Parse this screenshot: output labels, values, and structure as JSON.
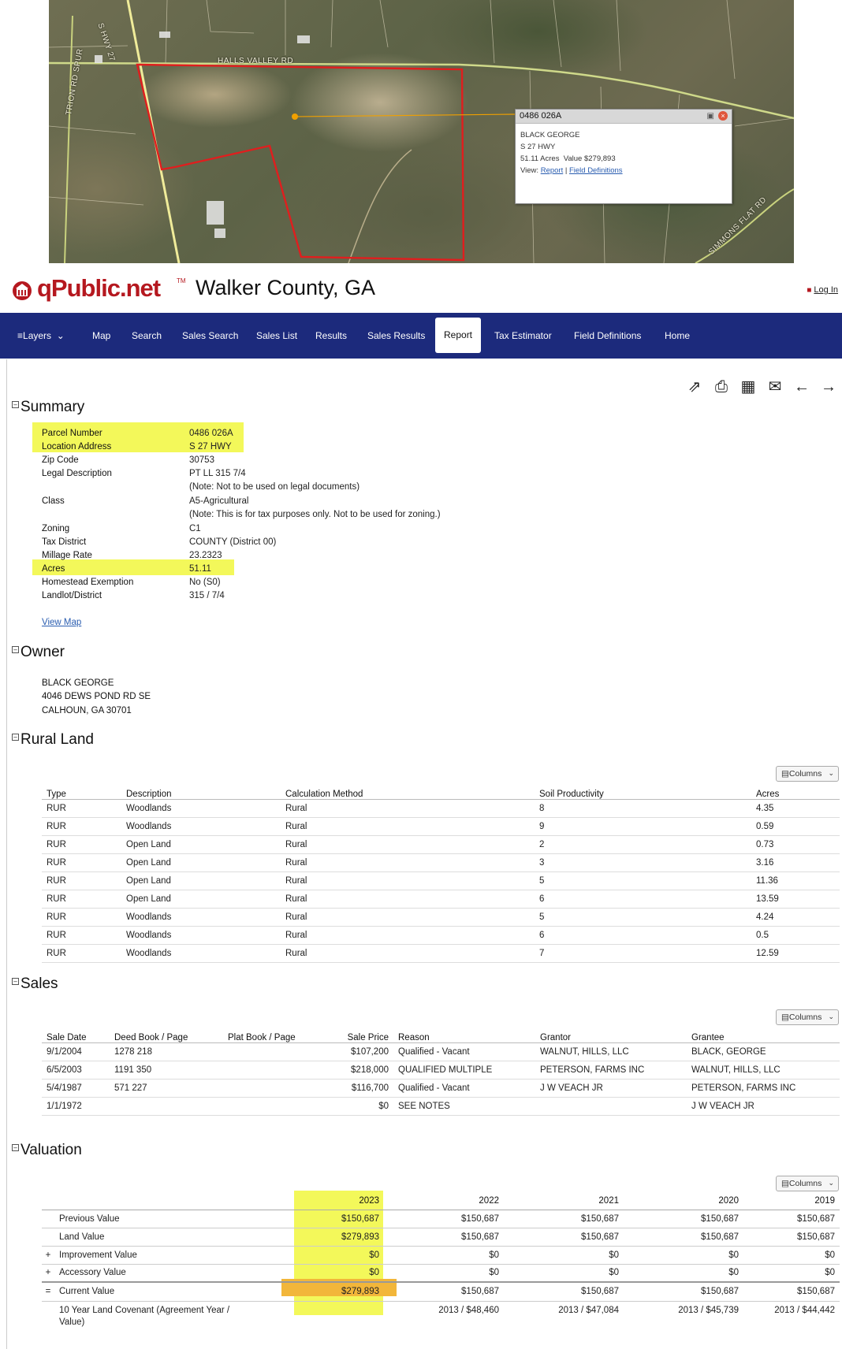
{
  "map": {
    "road_labels": {
      "halls_valley": "HALLS VALLEY RD",
      "hwy27": "S HWY 27",
      "trion_spur": "TRION RD SPUR",
      "simmons": "SIMMONS FLAT RD"
    },
    "popup": {
      "parcel": "0486 026A",
      "owner": "BLACK GEORGE",
      "address": "S 27 HWY",
      "acres_value": "51.11 Acres  Value $279,893",
      "view_label": "View:",
      "report_link": "Report",
      "separator": "|",
      "defs_link": "Field Definitions"
    }
  },
  "header": {
    "logo_text": "qPublic.net",
    "tm": "TM",
    "county": "Walker County, GA",
    "login": "Log In"
  },
  "nav": {
    "items": [
      "Layers",
      "Map",
      "Search",
      "Sales Search",
      "Sales List",
      "Results",
      "Sales Results",
      "Report",
      "Tax Estimator",
      "Field Definitions",
      "Home"
    ],
    "active": "Report"
  },
  "summary": {
    "title": "Summary",
    "rows": [
      {
        "k": "Parcel Number",
        "v": "0486 026A"
      },
      {
        "k": "Location Address",
        "v": "S 27 HWY"
      },
      {
        "k": "Zip Code",
        "v": "30753"
      },
      {
        "k": "Legal Description",
        "v": "PT LL 315 7/4"
      },
      {
        "k": "",
        "v": "(Note: Not to be used on legal documents)"
      },
      {
        "k": "Class",
        "v": "A5-Agricultural"
      },
      {
        "k": "",
        "v": "(Note: This is for tax purposes only. Not to be used for zoning.)"
      },
      {
        "k": "Zoning",
        "v": "C1"
      },
      {
        "k": "Tax District",
        "v": "COUNTY (District 00)"
      },
      {
        "k": "Millage Rate",
        "v": "23.2323"
      },
      {
        "k": "Acres",
        "v": "51.11"
      },
      {
        "k": "Homestead Exemption",
        "v": "No (S0)"
      },
      {
        "k": "Landlot/District",
        "v": "315 / 7/4"
      }
    ],
    "view_map": "View Map"
  },
  "owner": {
    "title": "Owner",
    "lines": [
      "BLACK GEORGE",
      "4046 DEWS POND RD SE",
      "CALHOUN, GA 30701"
    ]
  },
  "columns_label": "Columns",
  "rural_land": {
    "title": "Rural Land",
    "headers": [
      "Type",
      "Description",
      "Calculation Method",
      "Soil Productivity",
      "Acres"
    ],
    "rows": [
      [
        "RUR",
        "Woodlands",
        "Rural",
        "8",
        "4.35"
      ],
      [
        "RUR",
        "Woodlands",
        "Rural",
        "9",
        "0.59"
      ],
      [
        "RUR",
        "Open Land",
        "Rural",
        "2",
        "0.73"
      ],
      [
        "RUR",
        "Open Land",
        "Rural",
        "3",
        "3.16"
      ],
      [
        "RUR",
        "Open Land",
        "Rural",
        "5",
        "11.36"
      ],
      [
        "RUR",
        "Open Land",
        "Rural",
        "6",
        "13.59"
      ],
      [
        "RUR",
        "Woodlands",
        "Rural",
        "5",
        "4.24"
      ],
      [
        "RUR",
        "Woodlands",
        "Rural",
        "6",
        "0.5"
      ],
      [
        "RUR",
        "Woodlands",
        "Rural",
        "7",
        "12.59"
      ]
    ]
  },
  "sales": {
    "title": "Sales",
    "headers": [
      "Sale Date",
      "Deed Book / Page",
      "Plat Book / Page",
      "Sale Price",
      "Reason",
      "Grantor",
      "Grantee"
    ],
    "rows": [
      [
        "9/1/2004",
        "1278 218",
        "",
        "$107,200",
        "Qualified - Vacant",
        "WALNUT, HILLS, LLC",
        "BLACK, GEORGE"
      ],
      [
        "6/5/2003",
        "1191 350",
        "",
        "$218,000",
        "QUALIFIED MULTIPLE",
        "PETERSON, FARMS INC",
        "WALNUT, HILLS, LLC"
      ],
      [
        "5/4/1987",
        "571 227",
        "",
        "$116,700",
        "Qualified - Vacant",
        "J W VEACH JR",
        "PETERSON, FARMS INC"
      ],
      [
        "1/1/1972",
        "",
        "",
        "$0",
        "SEE NOTES",
        "",
        "J W VEACH JR"
      ]
    ]
  },
  "valuation": {
    "title": "Valuation",
    "years": [
      "2023",
      "2022",
      "2021",
      "2020",
      "2019"
    ],
    "rows": [
      {
        "op": "",
        "label": "Previous Value",
        "values": [
          "$150,687",
          "$150,687",
          "$150,687",
          "$150,687",
          "$150,687"
        ]
      },
      {
        "op": "",
        "label": "Land Value",
        "values": [
          "$279,893",
          "$150,687",
          "$150,687",
          "$150,687",
          "$150,687"
        ]
      },
      {
        "op": "+",
        "label": "Improvement Value",
        "values": [
          "$0",
          "$0",
          "$0",
          "$0",
          "$0"
        ]
      },
      {
        "op": "+",
        "label": "Accessory Value",
        "values": [
          "$0",
          "$0",
          "$0",
          "$0",
          "$0"
        ]
      },
      {
        "op": "=",
        "label": "Current Value",
        "values": [
          "$279,893",
          "$150,687",
          "$150,687",
          "$150,687",
          "$150,687"
        ]
      },
      {
        "op": "",
        "label": "10 Year Land Covenant (Agreement Year / Value)",
        "values": [
          "",
          "2013 / $48,460",
          "2013 / $47,084",
          "2013 / $45,739",
          "2013 / $44,442"
        ]
      }
    ]
  },
  "colors": {
    "nav_bg": "#1c2a7c",
    "brand_red": "#b5181f",
    "highlight_yellow": "#f3f85a",
    "highlight_orange": "#f2b63a",
    "parcel_outline": "#e01e1e",
    "note_red": "#c0392b"
  }
}
